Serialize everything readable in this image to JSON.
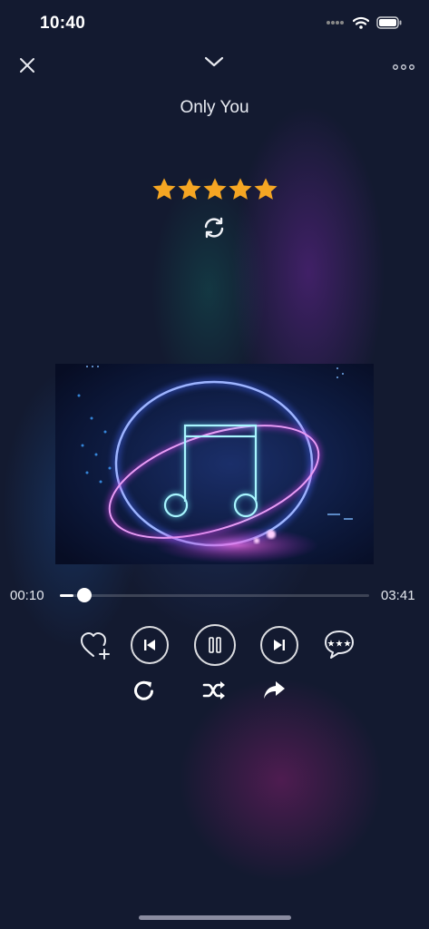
{
  "status_bar": {
    "time": "10:40",
    "icons": [
      "signal-dots-icon",
      "wifi-icon",
      "battery-icon"
    ]
  },
  "header": {
    "close_icon": "close-icon",
    "collapse_icon": "chevron-down-icon",
    "more_icon": "more-options-icon"
  },
  "song": {
    "title": "Only You",
    "rating": 5,
    "rating_max": 5,
    "star_color": "#f5a623"
  },
  "player": {
    "elapsed": "00:10",
    "duration": "03:41",
    "progress": 0.045
  },
  "controls": {
    "row1": [
      "add-favorite-icon",
      "previous-icon",
      "pause-icon",
      "next-icon",
      "comments-icon"
    ],
    "row2": [
      "repeat-icon",
      "shuffle-icon",
      "share-icon"
    ]
  },
  "colors": {
    "background": "#131a30",
    "artwork_bg": "#0d1a3e",
    "glow_blue": "#4a6bff",
    "glow_pink": "#d04bd8"
  }
}
